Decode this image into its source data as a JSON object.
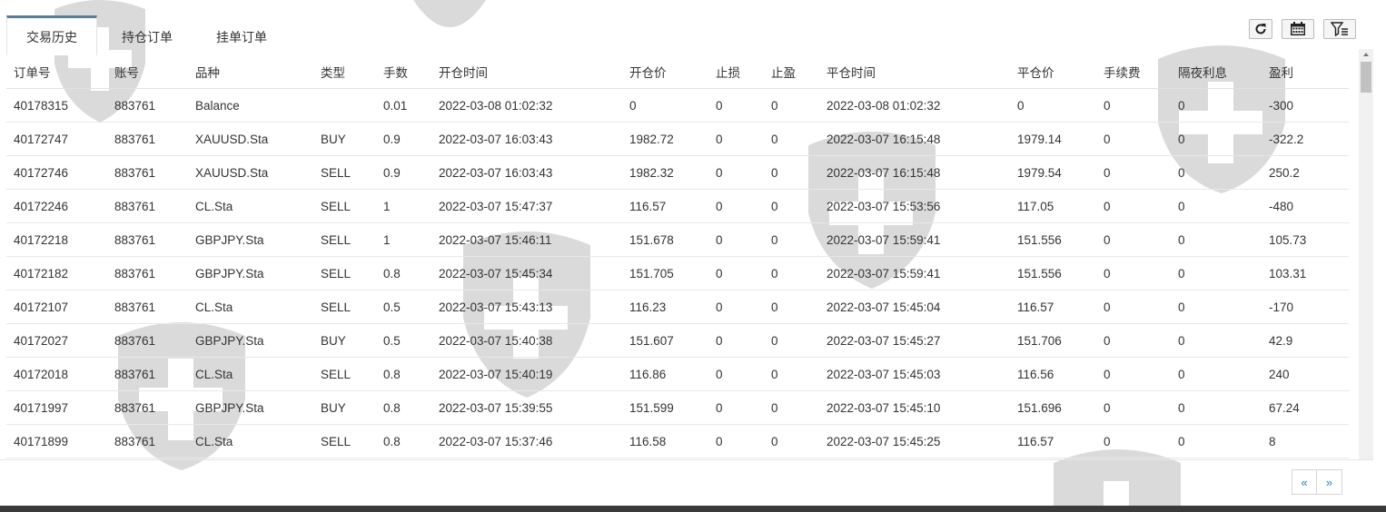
{
  "tabs": [
    {
      "label": "交易历史",
      "active": true
    },
    {
      "label": "持仓订单",
      "active": false
    },
    {
      "label": "挂单订单",
      "active": false
    }
  ],
  "toolbar": {
    "refresh_icon": "refresh-icon",
    "calendar_icon": "calendar-icon",
    "filter_icon": "filter-icon"
  },
  "close_icon": "close-icon",
  "table": {
    "headers": [
      "订单号",
      "账号",
      "品种",
      "类型",
      "手数",
      "开仓时间",
      "开仓价",
      "止损",
      "止盈",
      "平仓时间",
      "平仓价",
      "手续费",
      "隔夜利息",
      "盈利"
    ],
    "rows": [
      [
        "40178315",
        "883761",
        "Balance",
        "",
        "0.01",
        "2022-03-08 01:02:32",
        "0",
        "0",
        "0",
        "2022-03-08 01:02:32",
        "0",
        "0",
        "0",
        "-300"
      ],
      [
        "40172747",
        "883761",
        "XAUUSD.Sta",
        "BUY",
        "0.9",
        "2022-03-07 16:03:43",
        "1982.72",
        "0",
        "0",
        "2022-03-07 16:15:48",
        "1979.14",
        "0",
        "0",
        "-322.2"
      ],
      [
        "40172746",
        "883761",
        "XAUUSD.Sta",
        "SELL",
        "0.9",
        "2022-03-07 16:03:43",
        "1982.32",
        "0",
        "0",
        "2022-03-07 16:15:48",
        "1979.54",
        "0",
        "0",
        "250.2"
      ],
      [
        "40172246",
        "883761",
        "CL.Sta",
        "SELL",
        "1",
        "2022-03-07 15:47:37",
        "116.57",
        "0",
        "0",
        "2022-03-07 15:53:56",
        "117.05",
        "0",
        "0",
        "-480"
      ],
      [
        "40172218",
        "883761",
        "GBPJPY.Sta",
        "SELL",
        "1",
        "2022-03-07 15:46:11",
        "151.678",
        "0",
        "0",
        "2022-03-07 15:59:41",
        "151.556",
        "0",
        "0",
        "105.73"
      ],
      [
        "40172182",
        "883761",
        "GBPJPY.Sta",
        "SELL",
        "0.8",
        "2022-03-07 15:45:34",
        "151.705",
        "0",
        "0",
        "2022-03-07 15:59:41",
        "151.556",
        "0",
        "0",
        "103.31"
      ],
      [
        "40172107",
        "883761",
        "CL.Sta",
        "SELL",
        "0.5",
        "2022-03-07 15:43:13",
        "116.23",
        "0",
        "0",
        "2022-03-07 15:45:04",
        "116.57",
        "0",
        "0",
        "-170"
      ],
      [
        "40172027",
        "883761",
        "GBPJPY.Sta",
        "BUY",
        "0.5",
        "2022-03-07 15:40:38",
        "151.607",
        "0",
        "0",
        "2022-03-07 15:45:27",
        "151.706",
        "0",
        "0",
        "42.9"
      ],
      [
        "40172018",
        "883761",
        "CL.Sta",
        "SELL",
        "0.8",
        "2022-03-07 15:40:19",
        "116.86",
        "0",
        "0",
        "2022-03-07 15:45:03",
        "116.56",
        "0",
        "0",
        "240"
      ],
      [
        "40171997",
        "883761",
        "GBPJPY.Sta",
        "BUY",
        "0.8",
        "2022-03-07 15:39:55",
        "151.599",
        "0",
        "0",
        "2022-03-07 15:45:10",
        "151.696",
        "0",
        "0",
        "67.24"
      ],
      [
        "40171899",
        "883761",
        "CL.Sta",
        "SELL",
        "0.8",
        "2022-03-07 15:37:46",
        "116.58",
        "0",
        "0",
        "2022-03-07 15:45:25",
        "116.57",
        "0",
        "0",
        "8"
      ]
    ]
  },
  "pager": {
    "prev": "«",
    "next": "»"
  },
  "colors": {
    "accent_tab": "#5a7d9a",
    "link": "#2a7fbf"
  }
}
